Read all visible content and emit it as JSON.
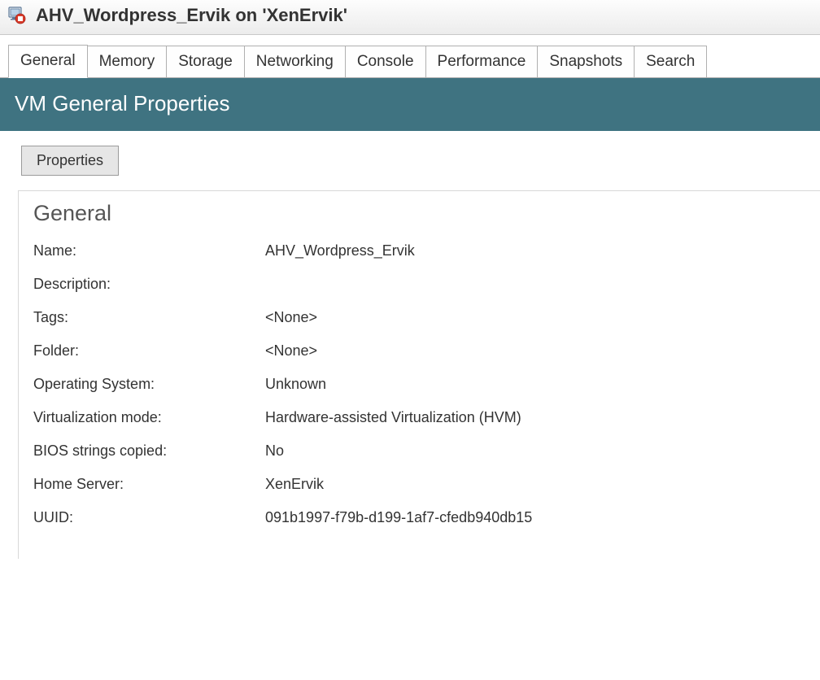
{
  "titlebar": {
    "text": "AHV_Wordpress_Ervik on 'XenErvik'"
  },
  "tabs": [
    {
      "label": "General",
      "active": true
    },
    {
      "label": "Memory",
      "active": false
    },
    {
      "label": "Storage",
      "active": false
    },
    {
      "label": "Networking",
      "active": false
    },
    {
      "label": "Console",
      "active": false
    },
    {
      "label": "Performance",
      "active": false
    },
    {
      "label": "Snapshots",
      "active": false
    },
    {
      "label": "Search",
      "active": false
    }
  ],
  "section": {
    "heading": "VM General Properties",
    "properties_button": "Properties",
    "group_heading": "General",
    "rows": [
      {
        "label": "Name:",
        "value": "AHV_Wordpress_Ervik"
      },
      {
        "label": "Description:",
        "value": ""
      },
      {
        "label": "Tags:",
        "value": "<None>"
      },
      {
        "label": "Folder:",
        "value": "<None>"
      },
      {
        "label": "Operating System:",
        "value": "Unknown"
      },
      {
        "label": "Virtualization mode:",
        "value": "Hardware-assisted Virtualization (HVM)"
      },
      {
        "label": "BIOS strings copied:",
        "value": "No"
      },
      {
        "label": "Home Server:",
        "value": "XenErvik"
      },
      {
        "label": "UUID:",
        "value": "091b1997-f79b-d199-1af7-cfedb940db15"
      }
    ]
  }
}
